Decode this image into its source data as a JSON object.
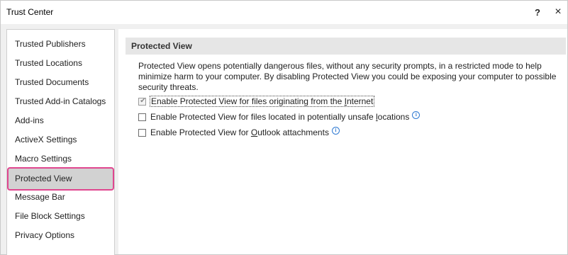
{
  "window": {
    "title": "Trust Center",
    "help_label": "?",
    "close_label": "×"
  },
  "sidebar": {
    "items": [
      {
        "label": "Trusted Publishers"
      },
      {
        "label": "Trusted Locations"
      },
      {
        "label": "Trusted Documents"
      },
      {
        "label": "Trusted Add-in Catalogs"
      },
      {
        "label": "Add-ins"
      },
      {
        "label": "ActiveX Settings"
      },
      {
        "label": "Macro Settings"
      },
      {
        "label": "Protected View",
        "selected": true
      },
      {
        "label": "Message Bar"
      },
      {
        "label": "File Block Settings"
      },
      {
        "label": "Privacy Options"
      }
    ]
  },
  "main": {
    "section_title": "Protected View",
    "description": "Protected View opens potentially dangerous files, without any security prompts, in a restricted mode to help minimize harm to your computer. By disabling Protected View you could be exposing your computer to possible security threats.",
    "options": [
      {
        "label_pre": "Enable Protected View for files originating from the ",
        "label_u": "I",
        "label_post": "nternet",
        "checked": true,
        "disabled": true,
        "info": false
      },
      {
        "label_pre": "Enable Protected View for files located in potentially unsafe ",
        "label_u": "l",
        "label_post": "ocations",
        "checked": false,
        "disabled": false,
        "info": true
      },
      {
        "label_pre": "Enable Protected View for ",
        "label_u": "O",
        "label_post": "utlook attachments",
        "checked": false,
        "disabled": false,
        "info": true
      }
    ],
    "info_glyph": "i",
    "check_glyph": "✔"
  },
  "colors": {
    "highlight_outline": "#e0468f",
    "selected_bg": "#d2d2d2",
    "info_blue": "#2f7ad2"
  }
}
